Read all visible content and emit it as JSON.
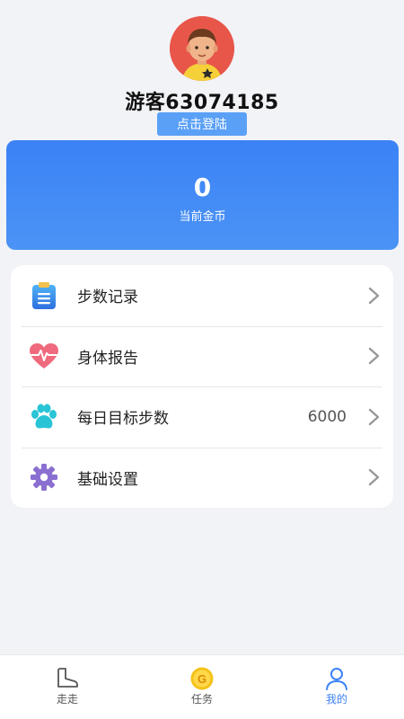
{
  "profile": {
    "username": "游客63074185",
    "login_label": "点击登陆"
  },
  "coins": {
    "value": "0",
    "label": "当前金币"
  },
  "menu": {
    "items": [
      {
        "label": "步数记录",
        "icon": "clipboard-icon"
      },
      {
        "label": "身体报告",
        "icon": "heart-rate-icon"
      },
      {
        "label": "每日目标步数",
        "value": "6000",
        "icon": "paw-icon"
      },
      {
        "label": "基础设置",
        "icon": "gear-icon"
      }
    ]
  },
  "bottom_nav": {
    "items": [
      {
        "label": "走走",
        "icon": "shoe-icon"
      },
      {
        "label": "任务",
        "icon": "coin-icon"
      },
      {
        "label": "我的",
        "icon": "user-icon",
        "active": true
      }
    ]
  },
  "colors": {
    "accent": "#3b82f6",
    "background": "#f2f3f7"
  }
}
